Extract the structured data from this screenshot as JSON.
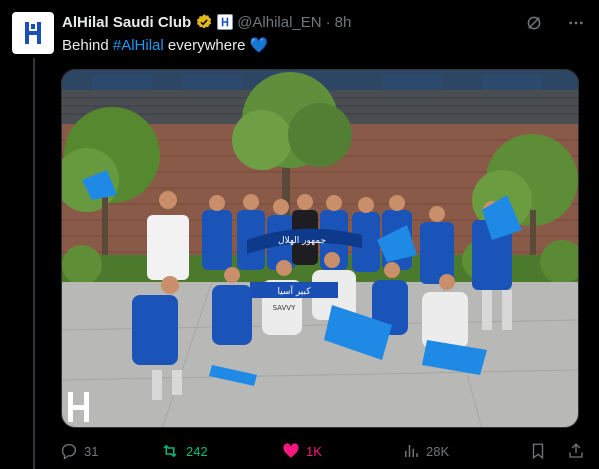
{
  "tweet": {
    "author_name": "AlHilal Saudi Club",
    "handle": "@Alhilal_EN",
    "dot": "·",
    "time": "8h",
    "text_prefix": "Behind ",
    "hashtag": "#AlHilal",
    "text_suffix": " everywhere",
    "emoji": "💙"
  },
  "media": {
    "alt": "Al Hilal fans posing with flags and scarves in front of a building",
    "banner_text": "جمهور الهلال",
    "sign_text": "كبير آسيا",
    "shirt_text": "SAVVY",
    "watermark_icon": "alhilal-logo-icon"
  },
  "actions": {
    "replies": "31",
    "reposts": "242",
    "likes": "1K",
    "views": "28K"
  },
  "colors": {
    "accent": "#1d9bf0",
    "repost": "#00ba7c",
    "like": "#f91880",
    "muted": "#71767b"
  }
}
